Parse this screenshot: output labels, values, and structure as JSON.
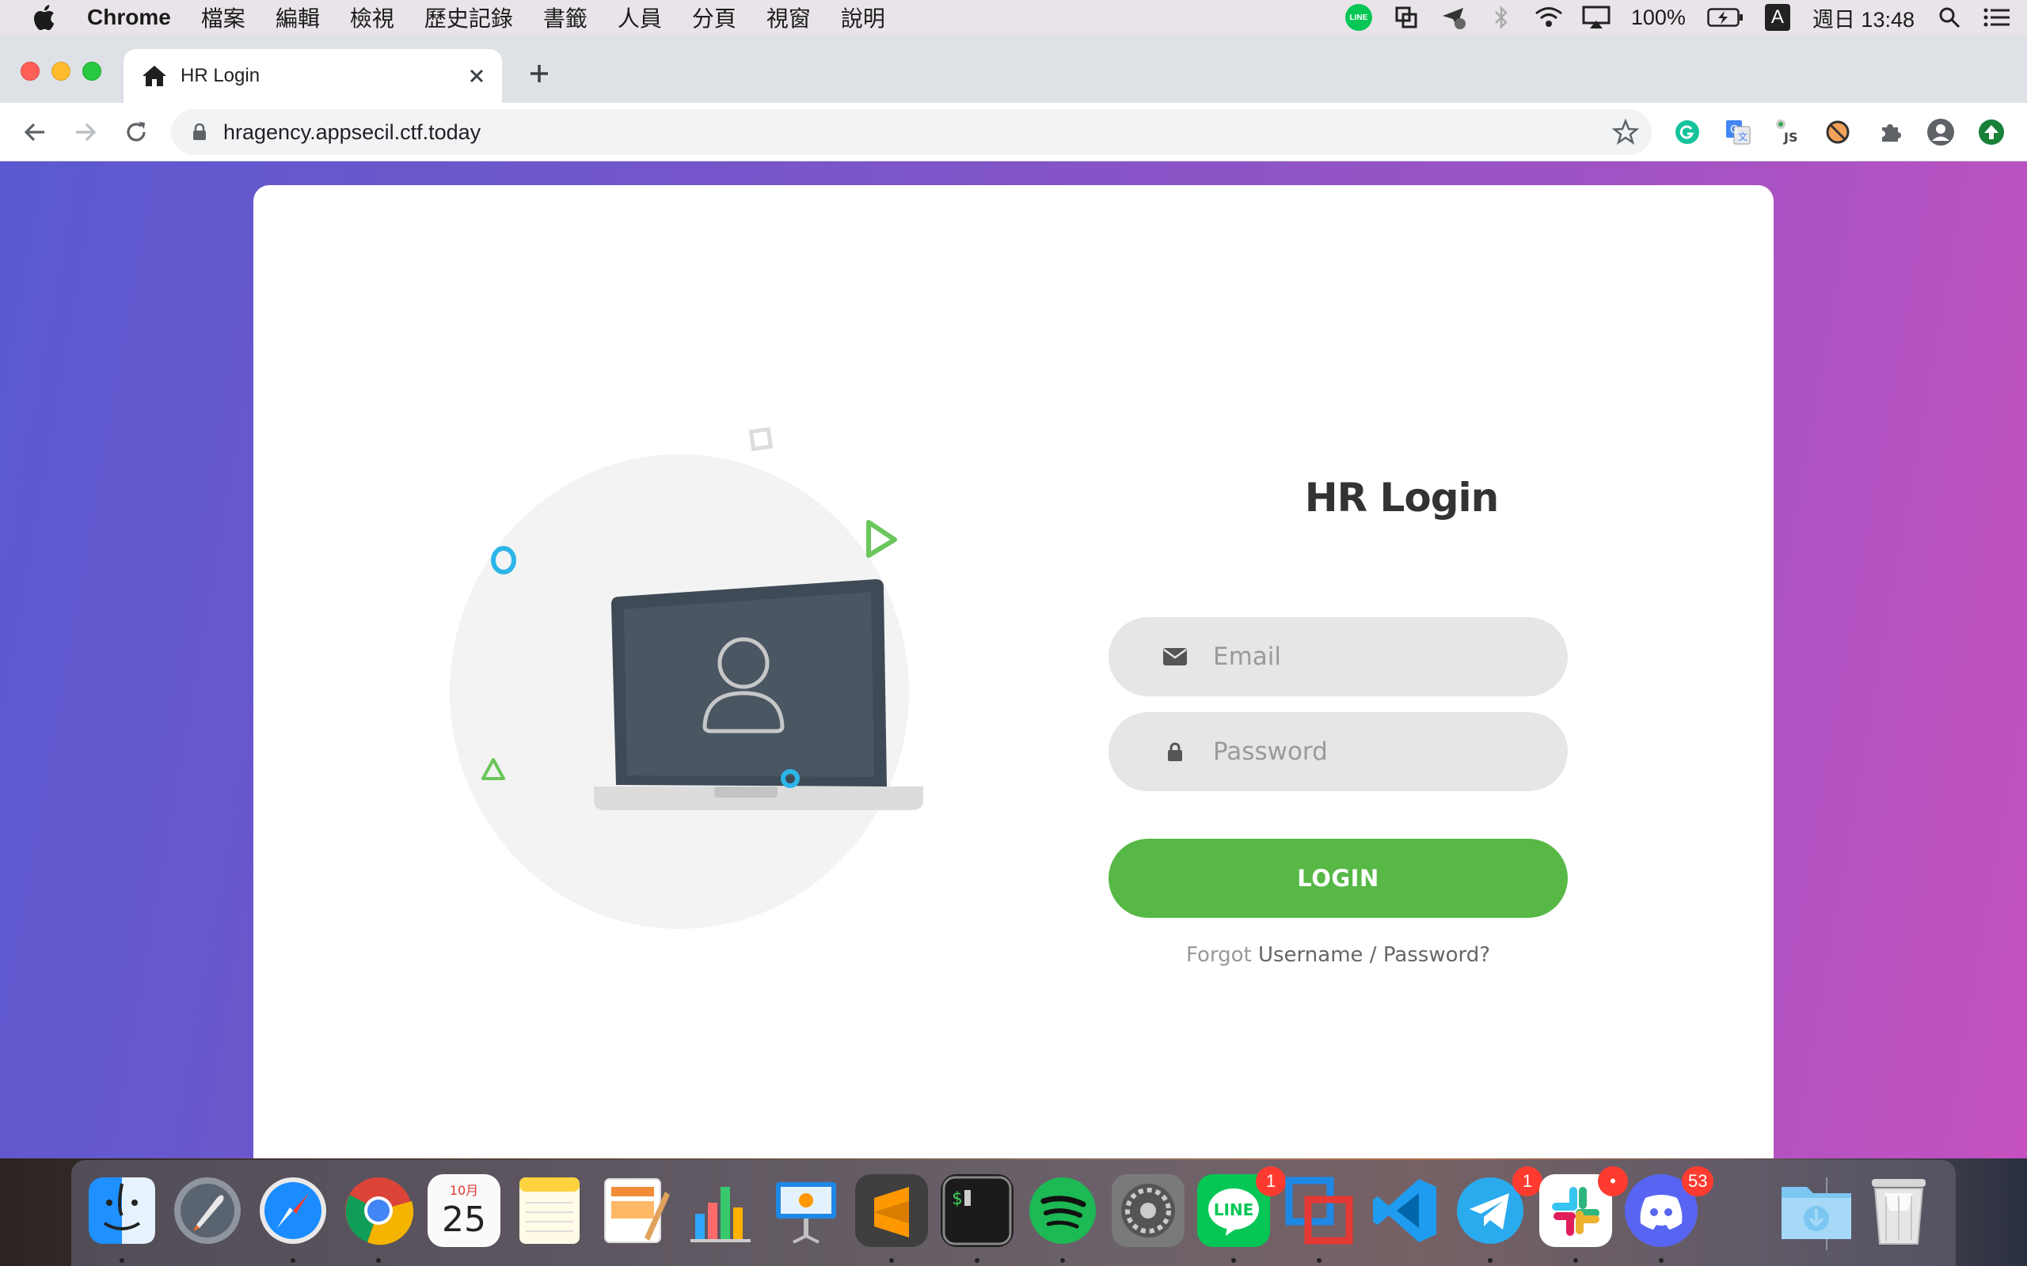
{
  "menubar": {
    "app_name": "Chrome",
    "menu_items": [
      "檔案",
      "編輯",
      "檢視",
      "歷史記錄",
      "書籤",
      "人員",
      "分頁",
      "視窗",
      "說明"
    ],
    "line_icon_text": "LINE",
    "battery": "100%",
    "input_method": "A",
    "clock": "週日 13:48"
  },
  "browser": {
    "tab_title": "HR Login",
    "url": "hragency.appsecil.ctf.today"
  },
  "page": {
    "title": "HR Login",
    "email_placeholder": "Email",
    "password_placeholder": "Password",
    "login_label": "LOGIN",
    "forgot_prefix": "Forgot",
    "forgot_link": "Username / Password?",
    "accent_color": "#57b846"
  },
  "dock": {
    "calendar_month": "10月",
    "calendar_day": "25",
    "line_label": "LINE",
    "badges": {
      "line": "1",
      "telegram": "1",
      "slack": "•",
      "discord": "53"
    },
    "icons": [
      "finder-icon",
      "launchpad-icon",
      "safari-icon",
      "chrome-icon",
      "calendar-icon",
      "notes-icon",
      "pages-icon",
      "numbers-icon",
      "keynote-icon",
      "sublime-text-icon",
      "terminal-icon",
      "spotify-icon",
      "system-preferences-icon",
      "line-icon",
      "parallels-icon",
      "vscode-icon",
      "telegram-icon",
      "slack-icon",
      "discord-icon",
      "downloads-folder-icon",
      "trash-icon"
    ]
  }
}
